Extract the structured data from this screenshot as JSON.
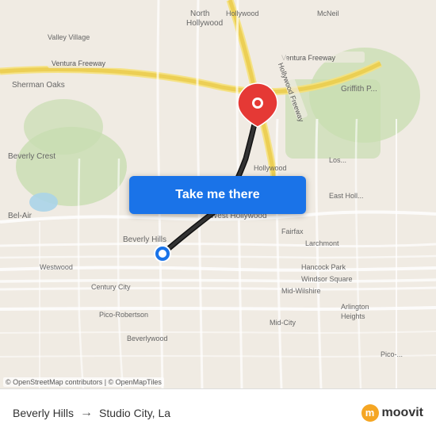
{
  "map": {
    "attribution": "© OpenStreetMap contributors | © OpenMapTiles",
    "center_lat": 34.07,
    "center_lng": -118.38
  },
  "button": {
    "label": "Take me there"
  },
  "footer": {
    "origin": "Beverly Hills",
    "destination": "Studio City, La",
    "arrow": "→",
    "logo_text": "moovit",
    "logo_initial": "m"
  }
}
